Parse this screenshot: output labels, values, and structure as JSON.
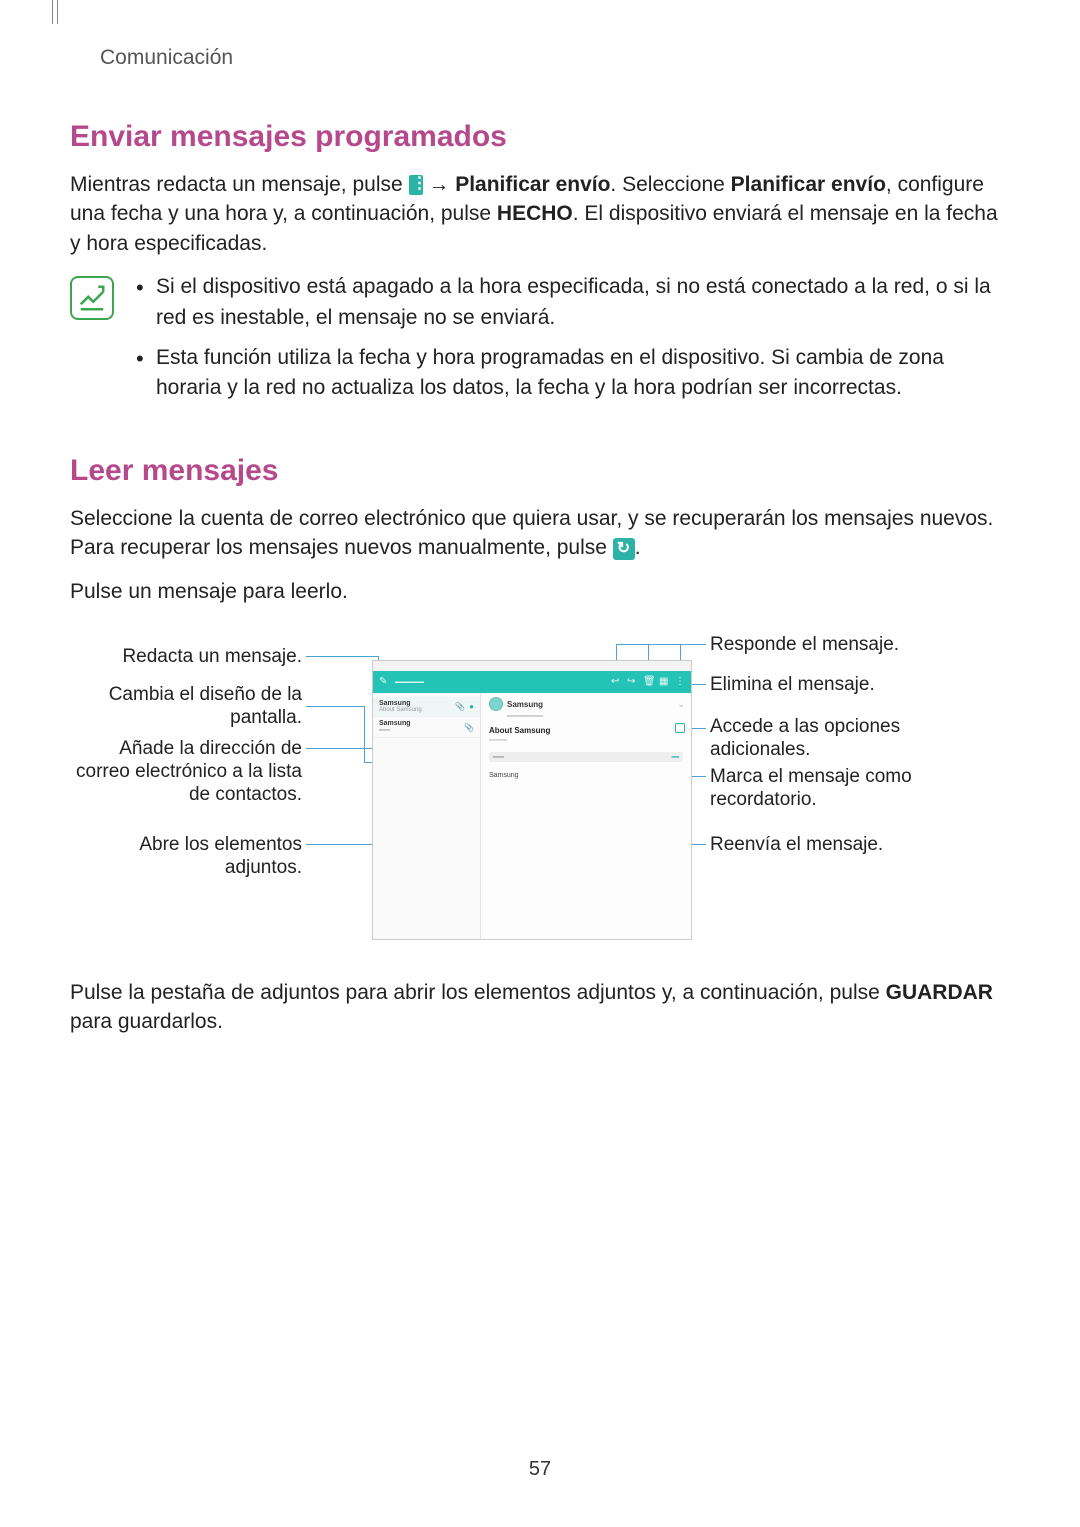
{
  "header": {
    "section": "Comunicación"
  },
  "section1": {
    "heading": "Enviar mensajes programados",
    "para_before_icon": "Mientras redacta un mensaje, pulse ",
    "after_icon": " → ",
    "bold1": "Planificar envío",
    "mid1": ". Seleccione ",
    "bold2": "Planificar envío",
    "mid2": ", configure una fecha y una hora y, a continuación, pulse ",
    "bold3": "HECHO",
    "end": ". El dispositivo enviará el mensaje en la fecha y hora especificadas.",
    "notes": [
      "Si el dispositivo está apagado a la hora especificada, si no está conectado a la red, o si la red es inestable, el mensaje no se enviará.",
      "Esta función utiliza la fecha y hora programadas en el dispositivo. Si cambia de zona horaria y la red no actualiza los datos, la fecha y la hora podrían ser incorrectas."
    ]
  },
  "section2": {
    "heading": "Leer mensajes",
    "para1a": "Seleccione la cuenta de correo electrónico que quiera usar, y se recuperarán los mensajes nuevos. Para recuperar los mensajes nuevos manualmente, pulse ",
    "para1b": ".",
    "para2": "Pulse un mensaje para leerlo."
  },
  "diagram": {
    "left": {
      "compose": "Redacta un mensaje.",
      "layout": "Cambia el diseño de la pantalla.",
      "addcontact": "Añade la dirección de correo electrónico a la lista de contactos.",
      "attachments": "Abre los elementos adjuntos."
    },
    "right": {
      "reply": "Responde el mensaje.",
      "delete": "Elimina el mensaje.",
      "options": "Accede a las opciones adicionales.",
      "flag": "Marca el mensaje como recordatorio.",
      "forward": "Reenvía el mensaje."
    },
    "mock": {
      "sender": "Samsung",
      "subject": "About Samsung",
      "body": "Samsung",
      "row1": "Samsung",
      "row1_sub": "About Samsung",
      "row2": "Samsung"
    }
  },
  "section3": {
    "para_a": "Pulse la pestaña de adjuntos para abrir los elementos adjuntos y, a continuación, pulse ",
    "bold": "GUARDAR",
    "para_b": " para guardarlos."
  },
  "page_number": "57"
}
